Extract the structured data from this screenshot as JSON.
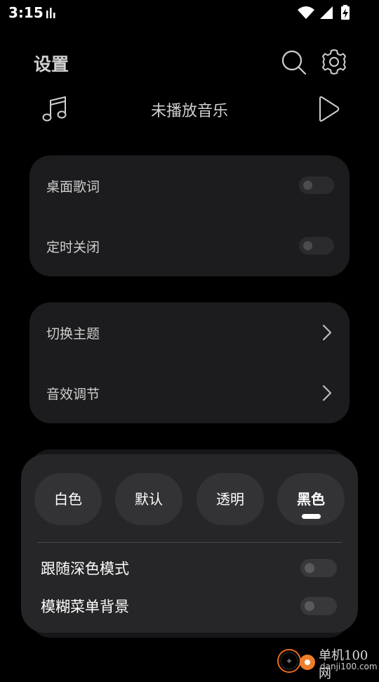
{
  "status_bar": {
    "time": "3:15"
  },
  "header": {
    "title": "设置",
    "search_icon": "search-icon",
    "settings_icon": "gear-icon"
  },
  "now_playing": {
    "text": "未播放音乐",
    "music_icon": "music-note-icon",
    "play_icon": "play-icon"
  },
  "cards": [
    {
      "rows": [
        {
          "label": "桌面歌词",
          "type": "toggle",
          "on": false
        },
        {
          "label": "定时关闭",
          "type": "toggle",
          "on": false
        }
      ]
    },
    {
      "rows": [
        {
          "label": "切换主题",
          "type": "chevron"
        },
        {
          "label": "音效调节",
          "type": "chevron"
        }
      ]
    }
  ],
  "theme_sheet": {
    "options": [
      "白色",
      "默认",
      "透明",
      "黑色"
    ],
    "selected": "黑色",
    "rows": [
      {
        "label": "跟随深色模式",
        "on": false
      },
      {
        "label": "模糊菜单背景",
        "on": false
      }
    ]
  },
  "watermark": {
    "title": "单机100网",
    "url": "danji100.com"
  },
  "colors": {
    "background": "#000000",
    "card": "#1c1c1e",
    "sheet": "#262628",
    "text": "#cfcfcf"
  }
}
